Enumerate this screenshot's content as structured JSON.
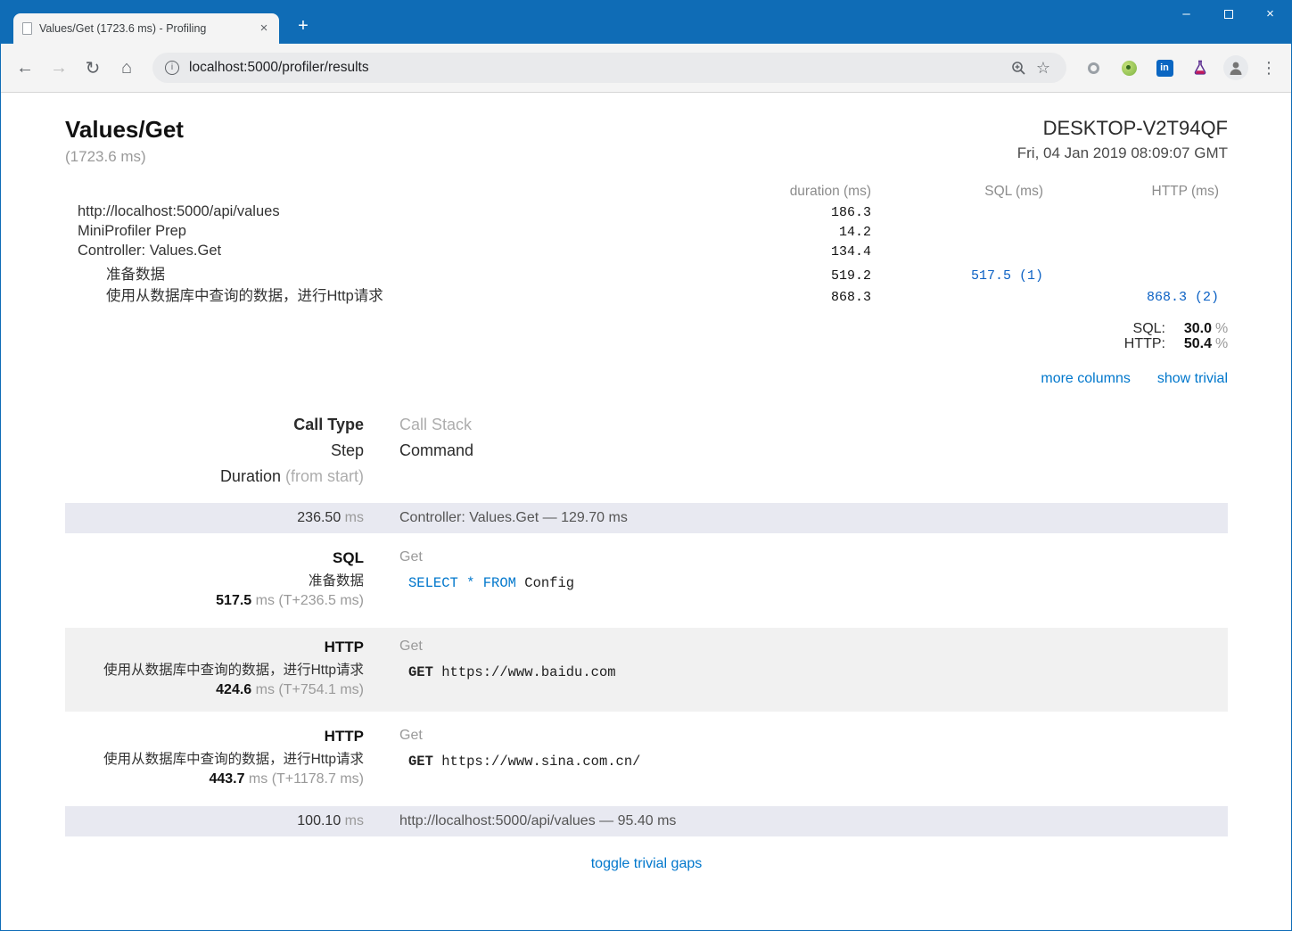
{
  "colors": {
    "titlebar": "#0f6cb6",
    "link": "#0077cc",
    "sql_keyword": "#0077cc",
    "metric_link": "#0b61c4",
    "gap_row_bg": "#e8e9f1",
    "alt_row_bg": "#f1f1f1",
    "linkedin_badge": "#0a66c2"
  },
  "icons": {
    "back": "←",
    "forward": "→",
    "reload": "↻",
    "home": "⌂",
    "info": "i",
    "star": "☆",
    "menu": "⋮"
  },
  "browser": {
    "tab_title": "Values/Get (1723.6 ms) - Profiling",
    "tab_close": "×",
    "new_tab": "+",
    "url": "localhost:5000/profiler/results",
    "controls": {
      "minimize": "–",
      "close": "×"
    }
  },
  "page": {
    "title": "Values/Get",
    "duration_total": "(1723.6 ms)",
    "machine": "DESKTOP-V2T94QF",
    "timestamp": "Fri, 04 Jan 2019 08:09:07 GMT",
    "summary": {
      "columns": [
        "duration (ms)",
        "SQL (ms)",
        "HTTP (ms)"
      ],
      "rows": [
        {
          "label": "http://localhost:5000/api/values",
          "indent": 0,
          "duration": "186.3",
          "sql": "",
          "http": ""
        },
        {
          "label": "MiniProfiler Prep",
          "indent": 0,
          "duration": "14.2",
          "sql": "",
          "http": ""
        },
        {
          "label": "Controller: Values.Get",
          "indent": 0,
          "duration": "134.4",
          "sql": "",
          "http": ""
        },
        {
          "label": "准备数据",
          "indent": 1,
          "duration": "519.2",
          "sql": "517.5 (1)",
          "http": ""
        },
        {
          "label": "使用从数据库中查询的数据，进行Http请求",
          "indent": 1,
          "duration": "868.3",
          "sql": "",
          "http": "868.3 (2)"
        }
      ],
      "percents": [
        {
          "label": "SQL:",
          "value": "30.0",
          "unit": "%"
        },
        {
          "label": "HTTP:",
          "value": "50.4",
          "unit": "%"
        }
      ],
      "links": [
        "more columns",
        "show trivial"
      ]
    },
    "legend": {
      "call_type": "Call Type",
      "call_stack": "Call Stack",
      "step": "Step",
      "command": "Command",
      "duration": "Duration",
      "duration_suffix": "(from start)"
    },
    "timeline": [
      {
        "kind": "gap",
        "duration": "236.50",
        "unit": "ms",
        "detail": "Controller: Values.Get — 129.70 ms"
      },
      {
        "kind": "step",
        "call_type": "SQL",
        "step": "准备数据",
        "duration": "517.5",
        "unit": "ms",
        "offset": "(T+236.5 ms)",
        "stack": "Get",
        "command": [
          {
            "text": "SELECT",
            "kw": true
          },
          {
            "text": " "
          },
          {
            "text": "*",
            "kw": true
          },
          {
            "text": " "
          },
          {
            "text": "FROM",
            "kw": true
          },
          {
            "text": " Config"
          }
        ]
      },
      {
        "kind": "step",
        "call_type": "HTTP",
        "step": "使用从数据库中查询的数据，进行Http请求",
        "duration": "424.6",
        "unit": "ms",
        "offset": "(T+754.1 ms)",
        "stack": "Get",
        "command": [
          {
            "text": "GET ",
            "bold": true
          },
          {
            "text": "https://www.baidu.com"
          }
        ]
      },
      {
        "kind": "step",
        "call_type": "HTTP",
        "step": "使用从数据库中查询的数据，进行Http请求",
        "duration": "443.7",
        "unit": "ms",
        "offset": "(T+1178.7 ms)",
        "stack": "Get",
        "command": [
          {
            "text": "GET ",
            "bold": true
          },
          {
            "text": "https://www.sina.com.cn/"
          }
        ]
      },
      {
        "kind": "gap",
        "duration": "100.10",
        "unit": "ms",
        "detail": "http://localhost:5000/api/values — 95.40 ms"
      }
    ],
    "footer_link": "toggle trivial gaps"
  }
}
